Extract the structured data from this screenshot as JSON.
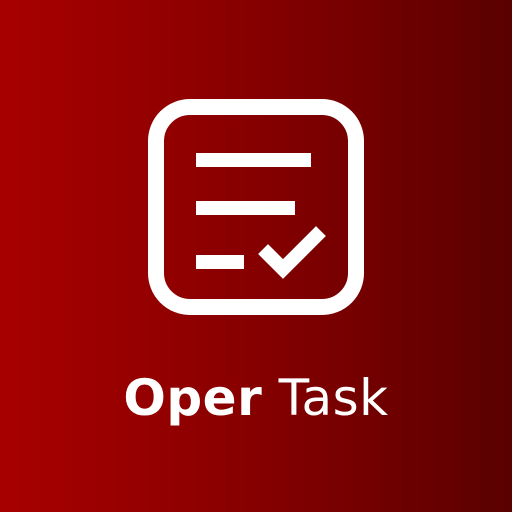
{
  "splash": {
    "icon": "task-checklist-icon",
    "app_name_bold": "Oper",
    "app_name_light": "Task"
  },
  "colors": {
    "background_start": "#a80000",
    "background_end": "#5a0000",
    "foreground": "#ffffff"
  }
}
